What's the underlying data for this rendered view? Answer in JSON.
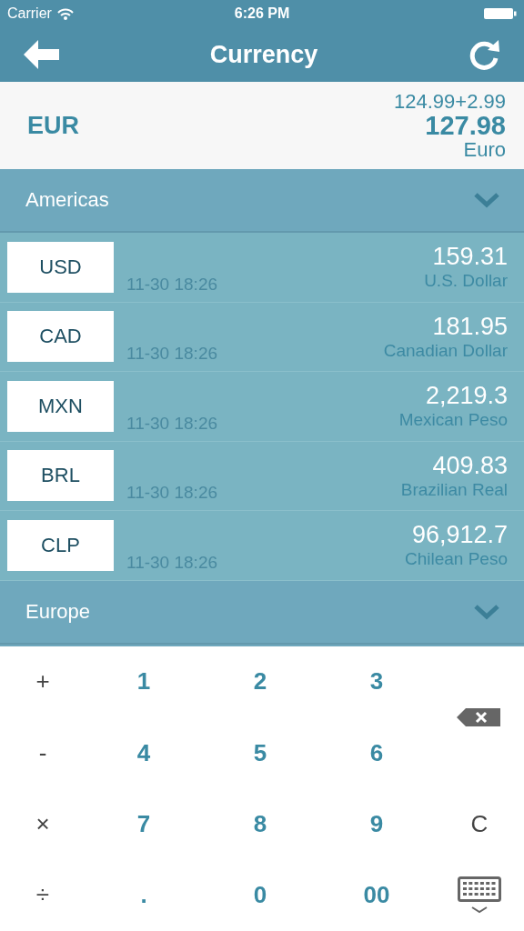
{
  "status_bar": {
    "carrier": "Carrier",
    "time": "6:26 PM"
  },
  "nav": {
    "title": "Currency"
  },
  "base": {
    "code": "EUR",
    "expression": "124.99+2.99",
    "amount": "127.98",
    "name": "Euro"
  },
  "sections": [
    {
      "name": "Americas",
      "rows": [
        {
          "code": "USD",
          "time": "11-30 18:26",
          "value": "159.31",
          "name": "U.S. Dollar"
        },
        {
          "code": "CAD",
          "time": "11-30 18:26",
          "value": "181.95",
          "name": "Canadian Dollar"
        },
        {
          "code": "MXN",
          "time": "11-30 18:26",
          "value": "2,219.3",
          "name": "Mexican Peso"
        },
        {
          "code": "BRL",
          "time": "11-30 18:26",
          "value": "409.83",
          "name": "Brazilian Real"
        },
        {
          "code": "CLP",
          "time": "11-30 18:26",
          "value": "96,912.7",
          "name": "Chilean Peso"
        }
      ]
    },
    {
      "name": "Europe"
    }
  ],
  "keypad": [
    {
      "kind": "operator",
      "label": "+"
    },
    {
      "kind": "digit",
      "label": "1"
    },
    {
      "kind": "digit",
      "label": "2"
    },
    {
      "kind": "digit",
      "label": "3"
    },
    {
      "kind": "backspace"
    },
    {
      "kind": "operator",
      "label": "-"
    },
    {
      "kind": "digit",
      "label": "4"
    },
    {
      "kind": "digit",
      "label": "5"
    },
    {
      "kind": "digit",
      "label": "6"
    },
    {
      "kind": "operator",
      "label": "×"
    },
    {
      "kind": "digit",
      "label": "7"
    },
    {
      "kind": "digit",
      "label": "8"
    },
    {
      "kind": "digit",
      "label": "9"
    },
    {
      "kind": "clear",
      "label": "C"
    },
    {
      "kind": "operator",
      "label": "÷"
    },
    {
      "kind": "digit",
      "label": "."
    },
    {
      "kind": "digit",
      "label": "0"
    },
    {
      "kind": "digit",
      "label": "00"
    },
    {
      "kind": "keyboard"
    }
  ]
}
